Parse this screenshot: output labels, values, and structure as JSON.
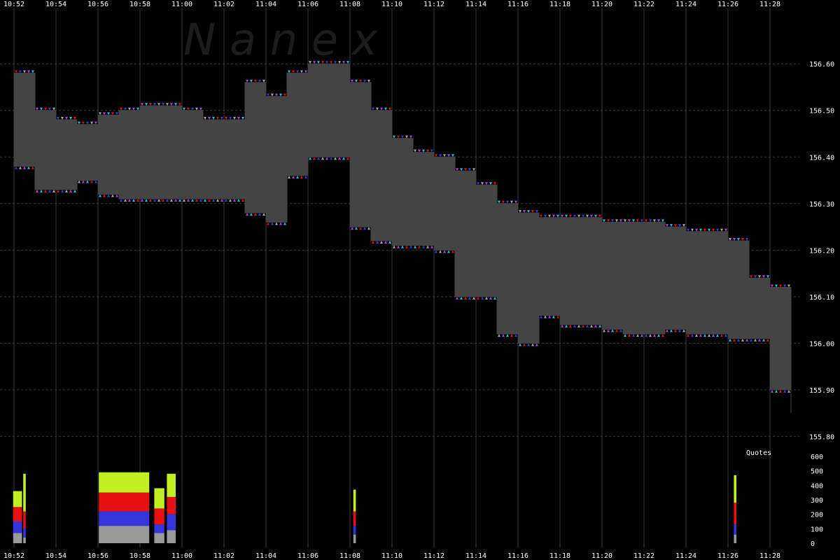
{
  "chart_data": [
    {
      "type": "area",
      "panel": "price",
      "watermark": "N a n e x",
      "x_ticks": [
        "10:52",
        "10:54",
        "10:56",
        "10:58",
        "11:00",
        "11:02",
        "11:04",
        "11:06",
        "11:08",
        "11:10",
        "11:12",
        "11:14",
        "11:16",
        "11:18",
        "11:20",
        "11:22",
        "11:24",
        "11:26",
        "11:28"
      ],
      "y_ticks": [
        "156.60",
        "156.50",
        "156.40",
        "156.30",
        "156.20",
        "156.10",
        "156.00",
        "155.90",
        "155.80"
      ],
      "ylim": [
        155.73,
        156.68
      ],
      "grid": true,
      "colors": {
        "spread": "#444444",
        "bid": "#3b3bdb",
        "ask": "#e01010",
        "neutral": "#a8a8a8",
        "violet": "#b040e0",
        "cyan": "#30b8e0"
      },
      "series": [
        {
          "x": [
            "10:52",
            "10:53",
            "10:54",
            "10:55",
            "10:56",
            "10:57",
            "10:58",
            "10:59",
            "11:00",
            "11:01",
            "11:02",
            "11:03",
            "11:04",
            "11:05",
            "11:06",
            "11:07",
            "11:08",
            "11:09",
            "11:10",
            "11:11",
            "11:12",
            "11:13",
            "11:14",
            "11:15",
            "11:16",
            "11:17",
            "11:18",
            "11:19",
            "11:20",
            "11:21",
            "11:22",
            "11:23",
            "11:24",
            "11:25",
            "11:26",
            "11:27",
            "11:28",
            "11:29"
          ],
          "ask": [
            156.58,
            156.5,
            156.48,
            156.47,
            156.49,
            156.5,
            156.51,
            156.51,
            156.5,
            156.48,
            156.48,
            156.56,
            156.53,
            156.58,
            156.6,
            156.6,
            156.56,
            156.5,
            156.44,
            156.41,
            156.4,
            156.37,
            156.34,
            156.3,
            156.28,
            156.27,
            156.27,
            156.27,
            156.26,
            156.26,
            156.26,
            156.25,
            156.24,
            156.24,
            156.22,
            156.14,
            156.12,
            156.12
          ],
          "bid": [
            156.38,
            156.33,
            156.33,
            156.35,
            156.32,
            156.31,
            156.31,
            156.31,
            156.31,
            156.31,
            156.31,
            156.28,
            156.26,
            156.36,
            156.4,
            156.4,
            156.25,
            156.22,
            156.21,
            156.21,
            156.2,
            156.1,
            156.1,
            156.02,
            156.0,
            156.06,
            156.04,
            156.04,
            156.03,
            156.02,
            156.02,
            156.03,
            156.02,
            156.02,
            156.01,
            156.01,
            155.9,
            155.85
          ]
        }
      ]
    },
    {
      "type": "bar",
      "panel": "volume",
      "legend": "Quotes",
      "y_ticks": [
        "600",
        "500",
        "400",
        "300",
        "200",
        "100",
        "0"
      ],
      "ylim": [
        0,
        600
      ],
      "colors": {
        "grey": "#9a9a9a",
        "blue": "#3535e0",
        "red": "#e81010",
        "lime": "#c0f020"
      },
      "series": [
        {
          "name": "grey",
          "segments": [
            [
              10.866,
              10.873,
              70
            ],
            [
              10.874,
              10.876,
              40
            ],
            [
              10.934,
              10.974,
              120
            ],
            [
              10.978,
              10.986,
              70
            ],
            [
              10.988,
              10.995,
              90
            ],
            [
              11.136,
              11.138,
              60
            ],
            [
              11.438,
              11.44,
              60
            ]
          ]
        },
        {
          "name": "blue",
          "segments": [
            [
              10.866,
              10.873,
              80
            ],
            [
              10.874,
              10.876,
              60
            ],
            [
              10.934,
              10.974,
              100
            ],
            [
              10.978,
              10.986,
              60
            ],
            [
              10.988,
              10.995,
              110
            ],
            [
              11.136,
              11.138,
              60
            ],
            [
              11.438,
              11.44,
              70
            ]
          ]
        },
        {
          "name": "red",
          "segments": [
            [
              10.866,
              10.873,
              100
            ],
            [
              10.874,
              10.876,
              120
            ],
            [
              10.934,
              10.974,
              130
            ],
            [
              10.978,
              10.986,
              110
            ],
            [
              10.988,
              10.995,
              120
            ],
            [
              11.136,
              11.138,
              100
            ],
            [
              11.438,
              11.44,
              150
            ]
          ]
        },
        {
          "name": "lime",
          "segments": [
            [
              10.866,
              10.873,
              110
            ],
            [
              10.874,
              10.876,
              260
            ],
            [
              10.934,
              10.974,
              140
            ],
            [
              10.978,
              10.986,
              140
            ],
            [
              10.988,
              10.995,
              160
            ],
            [
              11.136,
              11.138,
              150
            ],
            [
              11.438,
              11.44,
              190
            ]
          ]
        }
      ]
    }
  ]
}
